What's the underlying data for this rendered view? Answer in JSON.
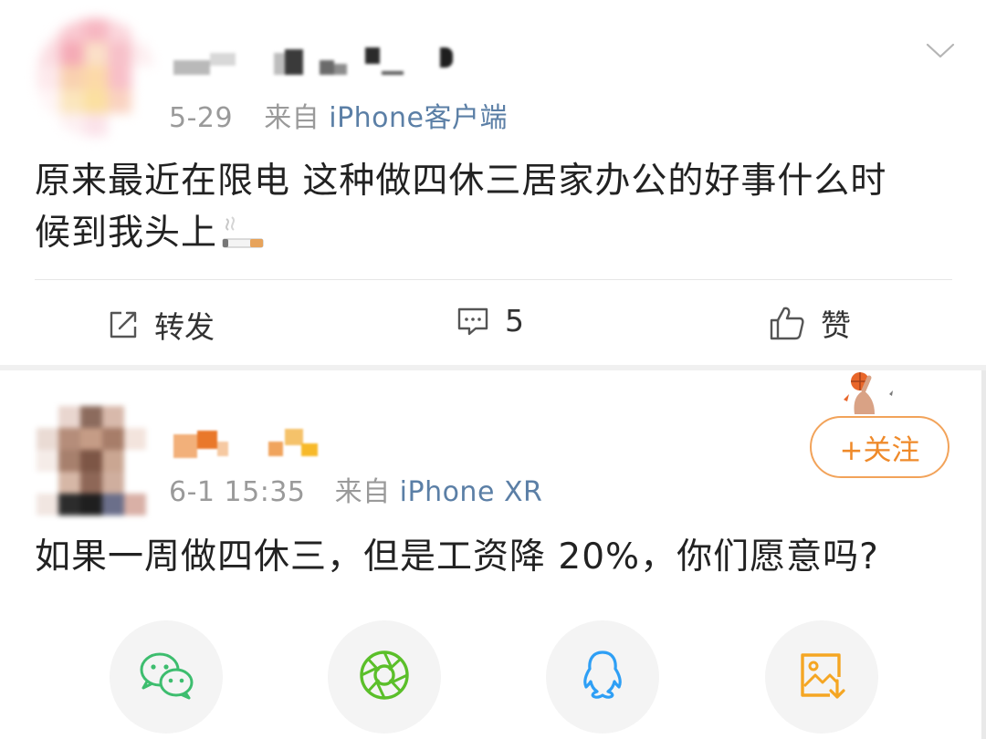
{
  "post1": {
    "date": "5-29",
    "from_label": "来自",
    "source": "iPhone客户端",
    "text_line1": "原来最近在限电 这种做四休三居家办公的好事什么时",
    "text_line2": "候到我头上",
    "emoji": "cigarette-emoji",
    "actions": {
      "repost_label": "转发",
      "comment_count": "5",
      "like_label": "赞"
    }
  },
  "post2": {
    "date": "6-1 15:35",
    "from_label": "来自",
    "source": "iPhone XR",
    "text": "如果一周做四休三，但是工资降 20%，你们愿意吗?",
    "follow_label": "+关注"
  },
  "share_bar": {
    "items": [
      "wechat-icon",
      "moments-icon",
      "qq-icon",
      "save-image-icon"
    ]
  },
  "colors": {
    "link_blue": "#5b7fa6",
    "follow_orange": "#ef8a2a",
    "wechat_green": "#3dbd6e",
    "qq_blue": "#2e9ff5",
    "save_orange": "#f5a623"
  }
}
